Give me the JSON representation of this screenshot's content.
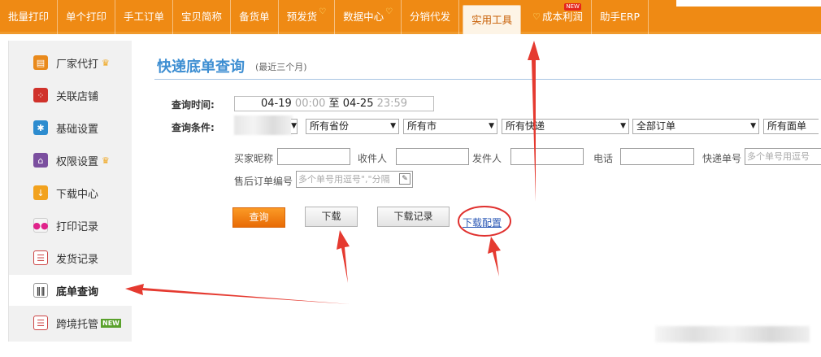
{
  "nav": {
    "tabs": [
      {
        "label": "批量打印"
      },
      {
        "label": "单个打印"
      },
      {
        "label": "手工订单"
      },
      {
        "label": "宝贝简称"
      },
      {
        "label": "备货单"
      },
      {
        "label": "预发货",
        "marker": "heart-icon"
      },
      {
        "label": "数据中心",
        "marker": "heart-icon"
      },
      {
        "label": "分销代发"
      },
      {
        "label": "实用工具",
        "active": true
      },
      {
        "label": "成本利润",
        "marker": "heart-icon",
        "badge": "NEW"
      },
      {
        "label": "助手ERP"
      }
    ],
    "colors": {
      "bar": "#ef8a14",
      "active_bg": "#fdf4e6",
      "active_text": "#c85f05"
    }
  },
  "sidebar": {
    "items": [
      {
        "label": "厂家代打",
        "icon": "printer-icon",
        "crown": true
      },
      {
        "label": "关联店铺",
        "icon": "dice-icon"
      },
      {
        "label": "基础设置",
        "icon": "gear-icon"
      },
      {
        "label": "权限设置",
        "icon": "lock-icon",
        "crown": true
      },
      {
        "label": "下载中心",
        "icon": "download-icon"
      },
      {
        "label": "打印记录",
        "icon": "dots-icon"
      },
      {
        "label": "发货记录",
        "icon": "list-icon"
      },
      {
        "label": "底单查询",
        "icon": "barcode-icon",
        "active": true
      },
      {
        "label": "跨境托管",
        "icon": "list-icon",
        "badge": "NEW"
      }
    ]
  },
  "main": {
    "title": "快递底单查询",
    "subtitle": "(最近三个月)",
    "time_label": "查询时间:",
    "time": {
      "start_date": "04-19",
      "start_time": "00:00",
      "sep": "至",
      "end_date": "04-25",
      "end_time": "23:59"
    },
    "cond_label": "查询条件:",
    "selects": [
      "所有省份",
      "所有市",
      "所有快递",
      "全部订单",
      "所有面单"
    ],
    "fields": {
      "buyer": {
        "label": "买家昵称",
        "value": ""
      },
      "receiver": {
        "label": "收件人",
        "value": ""
      },
      "sender": {
        "label": "发件人",
        "value": ""
      },
      "phone": {
        "label": "电话",
        "value": ""
      },
      "tracking": {
        "label": "快递单号",
        "placeholder": "多个单号用逗号"
      },
      "aftersale": {
        "label": "售后订单编号",
        "placeholder": "多个单号用逗号\",\"分隔"
      }
    },
    "buttons": {
      "query": "查询",
      "download": "下载",
      "download_log": "下载记录",
      "download_config": "下载配置"
    }
  }
}
